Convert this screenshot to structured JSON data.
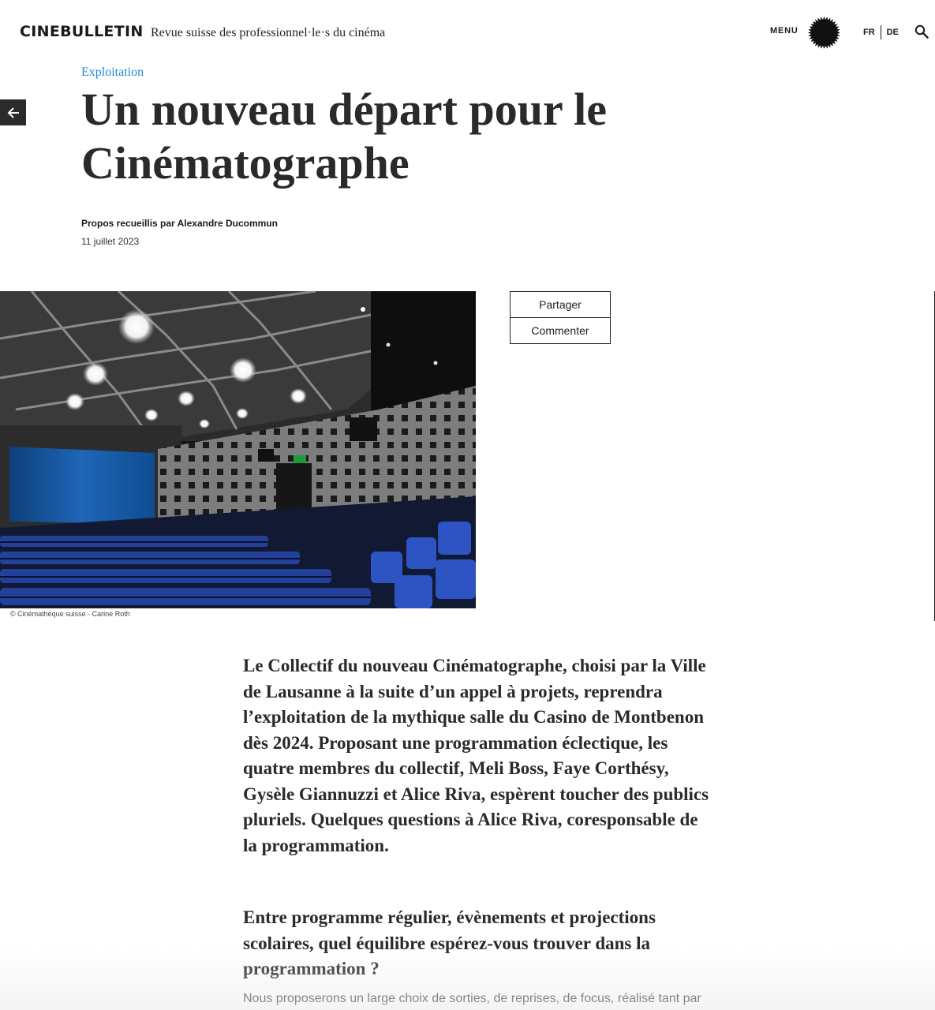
{
  "header": {
    "brand": "CINEBULLETIN",
    "tagline": "Revue suisse des professionnel·le·s du cinéma",
    "menu_label": "MENU",
    "languages": [
      "FR",
      "DE"
    ]
  },
  "article": {
    "category": "Exploitation",
    "title": "Un nouveau départ pour le Cinématographe",
    "author": "Propos recueillis par Alexandre Ducommun",
    "date": "11 juillet 2023",
    "photo_credit": "© Cinémathèque suisse - Carine Roth",
    "share_label": "Partager",
    "comment_label": "Commenter",
    "lead": "Le Collectif du nouveau Cinématographe, choisi par la Ville de Lausanne à la suite d’un appel à projets, reprendra l’exploitation de la mythique salle du Casino de Montbenon dès 2024. Proposant une programmation éclectique, les quatre membres du collectif, Meli Boss, Faye Corthésy, Gysèle Giannuzzi et Alice Riva, espèrent toucher des publics pluriels. Quelques questions à Alice Riva, coresponsable de la programmation.",
    "question": "Entre programme régulier, évènements et projections scolaires, quel équilibre espérez-vous trouver dans la programmation ?",
    "paragraph": "Nous proposerons un large choix de sorties, de reprises, de focus, réalisé tant par"
  },
  "colors": {
    "accent": "#1e88d6",
    "text": "#2a2a2a",
    "seat_blue": "#1f3a8a"
  },
  "icons": {
    "back": "arrow-left-icon",
    "search": "search-icon",
    "menu": "starburst-icon"
  }
}
